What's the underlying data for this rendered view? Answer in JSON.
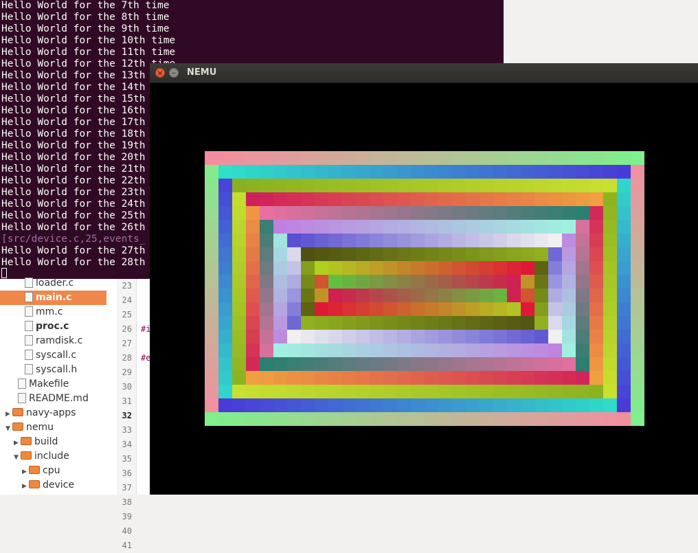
{
  "terminal": {
    "lines": [
      "Hello World for the 7th time",
      "Hello World for the 8th time",
      "Hello World for the 9th time",
      "Hello World for the 10th time",
      "Hello World for the 11th time",
      "Hello World for the 12th time",
      "Hello World for the 13th",
      "Hello World for the 14th",
      "Hello World for the 15th",
      "Hello World for the 16th",
      "Hello World for the 17th",
      "Hello World for the 18th",
      "Hello World for the 19th",
      "Hello World for the 20th",
      "Hello World for the 21th",
      "Hello World for the 22th",
      "Hello World for the 23th",
      "Hello World for the 24th",
      "Hello World for the 25th",
      "Hello World for the 26th",
      "[src/device.c,25,events_",
      "Hello World for the 27th",
      "Hello World for the 28th"
    ],
    "background": "#300a24"
  },
  "tree": {
    "items": [
      {
        "label": "loader.c",
        "type": "file",
        "indent": 2
      },
      {
        "label": "main.c",
        "type": "file",
        "indent": 2,
        "selected": true
      },
      {
        "label": "mm.c",
        "type": "file",
        "indent": 2
      },
      {
        "label": "proc.c",
        "type": "file",
        "indent": 2,
        "bold": true
      },
      {
        "label": "ramdisk.c",
        "type": "file",
        "indent": 2
      },
      {
        "label": "syscall.c",
        "type": "file",
        "indent": 2
      },
      {
        "label": "syscall.h",
        "type": "file",
        "indent": 2
      },
      {
        "label": "Makefile",
        "type": "file",
        "indent": 1
      },
      {
        "label": "README.md",
        "type": "file",
        "indent": 1
      },
      {
        "label": "navy-apps",
        "type": "folder",
        "indent": 0,
        "expanded": false
      },
      {
        "label": "nemu",
        "type": "folder",
        "indent": 0,
        "expanded": true
      },
      {
        "label": "build",
        "type": "folder",
        "indent": 1,
        "expanded": false
      },
      {
        "label": "include",
        "type": "folder",
        "indent": 1,
        "expanded": true
      },
      {
        "label": "cpu",
        "type": "folder",
        "indent": 2,
        "expanded": false
      },
      {
        "label": "device",
        "type": "folder",
        "indent": 2,
        "expanded": false
      }
    ]
  },
  "gutter": {
    "line_numbers": [
      "23",
      "24",
      "25",
      "26",
      "27",
      "28",
      "29",
      "30",
      "31",
      "32",
      "33",
      "34",
      "35",
      "36",
      "37",
      "38",
      "39",
      "40",
      "41"
    ],
    "current_line": "32",
    "code_fragments": [
      "#i",
      "#e"
    ]
  },
  "nemu_window": {
    "title": "NEMU",
    "close_icon": "close-icon",
    "minimize_icon": "minimize-icon"
  }
}
